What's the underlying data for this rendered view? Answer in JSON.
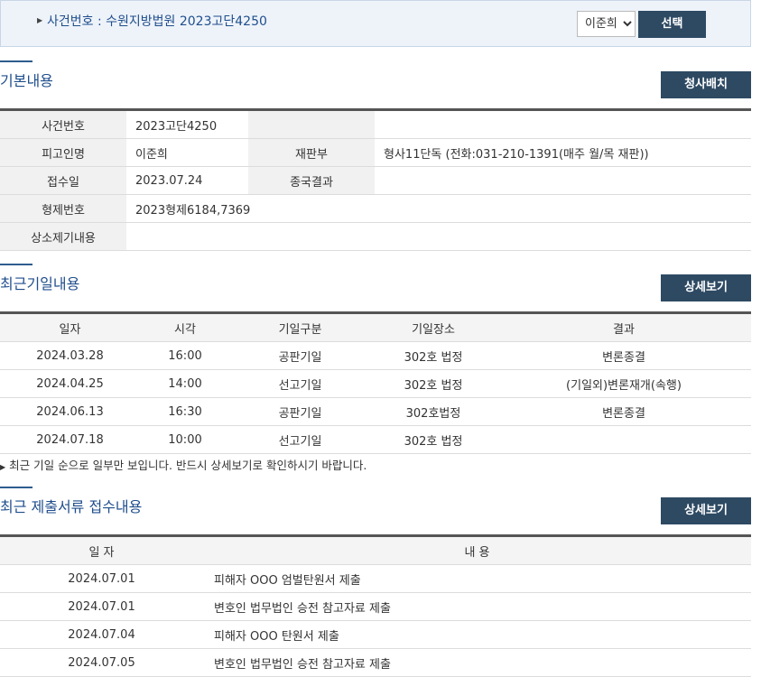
{
  "header": {
    "case_title": "사건번호 : 수원지방법원 2023고단4250",
    "person_select_value": "이준희",
    "select_button_label": "선택"
  },
  "basic": {
    "title": "기본내용",
    "button_label": "청사배치",
    "rows": {
      "case_no_label": "사건번호",
      "case_no_value": "2023고단4250",
      "defendant_label": "피고인명",
      "defendant_value": "이준희",
      "court_label": "재판부",
      "court_value": "형사11단독 (전화:031-210-1391(매주 월/목 재판))",
      "receipt_label": "접수일",
      "receipt_value": "2023.07.24",
      "final_label": "종국결과",
      "final_value": "",
      "sentence_label": "형제번호",
      "sentence_value": "2023형제6184,7369",
      "appeal_label": "상소제기내용",
      "appeal_value": ""
    }
  },
  "hearings": {
    "title": "최근기일내용",
    "button_label": "상세보기",
    "columns": [
      "일자",
      "시각",
      "기일구분",
      "기일장소",
      "결과"
    ],
    "rows": [
      [
        "2024.03.28",
        "16:00",
        "공판기일",
        "302호 법정",
        "변론종결"
      ],
      [
        "2024.04.25",
        "14:00",
        "선고기일",
        "302호 법정",
        "(기일외)변론재개(속행)"
      ],
      [
        "2024.06.13",
        "16:30",
        "공판기일",
        "302호법정",
        "변론종결"
      ],
      [
        "2024.07.18",
        "10:00",
        "선고기일",
        "302호 법정",
        ""
      ]
    ],
    "note": "최근 기일 순으로 일부만 보입니다. 반드시 상세보기로 확인하시기 바랍니다."
  },
  "documents": {
    "title": "최근 제출서류 접수내용",
    "button_label": "상세보기",
    "columns": [
      "일 자",
      "내 용"
    ],
    "rows": [
      [
        "2024.07.01",
        "피해자 OOO 엄벌탄원서 제출"
      ],
      [
        "2024.07.01",
        "변호인 법무법인 승전 참고자료 제출"
      ],
      [
        "2024.07.04",
        "피해자 OOO 탄원서 제출"
      ],
      [
        "2024.07.05",
        "변호인 법무법인 승전 참고자료 제출"
      ]
    ]
  }
}
